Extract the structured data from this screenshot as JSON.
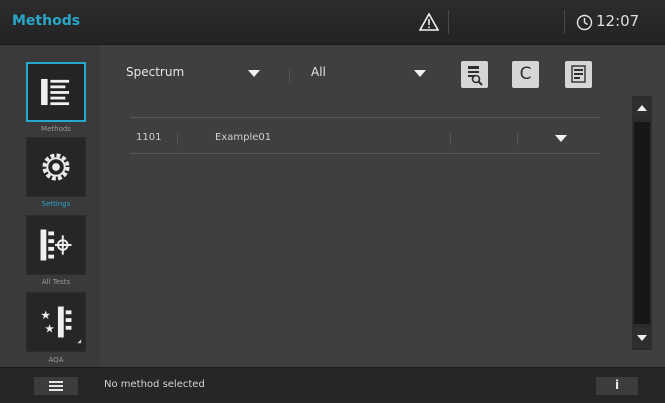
{
  "header": {
    "title": "Methods",
    "warning_icon": "warning-triangle-icon",
    "clock_icon": "clock-icon",
    "time": "12:07"
  },
  "nav": {
    "items": [
      {
        "label": "Methods",
        "icon": "methods-list-icon",
        "active": true
      },
      {
        "label": "Settings",
        "icon": "gear-icon",
        "active": false
      },
      {
        "label": "All Tests",
        "icon": "tests-icon",
        "active": false
      },
      {
        "label": "AQA",
        "icon": "aqa-icon",
        "active": false
      }
    ]
  },
  "filters": {
    "type_value": "Spectrum",
    "category_value": "All"
  },
  "toolbar": {
    "icons": [
      "search-document-icon",
      "clear-c-icon",
      "export-document-icon"
    ],
    "clear_letter": "C"
  },
  "method_row": {
    "number": "1101",
    "name": "Example01"
  },
  "status": {
    "message": "No method selected",
    "menu_icon": "hamburger-menu-icon",
    "info_label": "i"
  },
  "colors": {
    "accent": "#2aa6c9",
    "background": "#3f3f3f",
    "bar": "#262626"
  }
}
